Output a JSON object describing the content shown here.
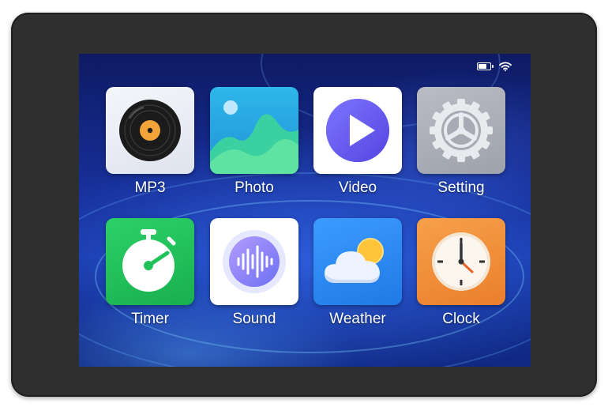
{
  "status_bar": {
    "battery_level": 0.7,
    "icons": [
      "battery-icon",
      "wifi-icon"
    ]
  },
  "apps": [
    {
      "label": "MP3",
      "icon": "vinyl-record-icon"
    },
    {
      "label": "Photo",
      "icon": "photo-mountains-icon"
    },
    {
      "label": "Video",
      "icon": "play-icon"
    },
    {
      "label": "Setting",
      "icon": "gear-wheel-icon"
    },
    {
      "label": "Timer",
      "icon": "stopwatch-icon"
    },
    {
      "label": "Sound",
      "icon": "sound-wave-icon"
    },
    {
      "label": "Weather",
      "icon": "cloud-sun-icon"
    },
    {
      "label": "Clock",
      "icon": "clock-icon"
    }
  ],
  "colors": {
    "bezel": "#2f2f2f",
    "photo_tile": "#2aa6e0",
    "video_play": "#6a5ef0",
    "timer_tile": "#22c25a",
    "weather_tile": "#2f8cf0",
    "clock_tile": "#f0913a"
  }
}
